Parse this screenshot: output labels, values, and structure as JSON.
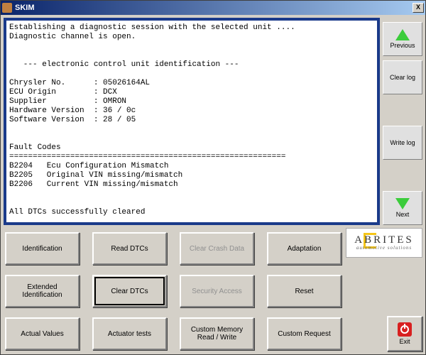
{
  "window": {
    "title": "SKIM",
    "close_x": "X"
  },
  "console": {
    "line1": "Establishing a diagnostic session with the selected unit ....",
    "line2": "Diagnostic channel is open.",
    "ecu_header": "   --- electronic control unit identification ---",
    "id_rows": {
      "r1": "Chrysler No.      : 05026164AL",
      "r2": "ECU Origin        : DCX",
      "r3": "Supplier          : OMRON",
      "r4": "Hardware Version  : 36 / 0c",
      "r5": "Software Version  : 28 / 05"
    },
    "faults_header": "Fault Codes",
    "faults_sep": "===========================================================",
    "faults": {
      "f1": "B2204   Ecu Configuration Mismatch",
      "f2": "B2205   Original VIN missing/mismatch",
      "f3": "B2206   Current VIN missing/mismatch"
    },
    "cleared": "All DTCs successfully cleared"
  },
  "side": {
    "previous": "Previous",
    "clear_log": "Clear log",
    "write_log": "Write log",
    "next": "Next"
  },
  "grid": {
    "b0": "Identification",
    "b1": "Read DTCs",
    "b2": "Clear Crash Data",
    "b3": "Adaptation",
    "b4": "Extended Identification",
    "b5": "Clear DTCs",
    "b6": "Security Access",
    "b7": "Reset",
    "b8": "Actual Values",
    "b9": "Actuator tests",
    "b10": "Custom Memory Read / Write",
    "b11": "Custom Request"
  },
  "logo": {
    "brand": "ABRITES",
    "tagline": "automotive solutions"
  },
  "exit": {
    "label": "Exit"
  }
}
